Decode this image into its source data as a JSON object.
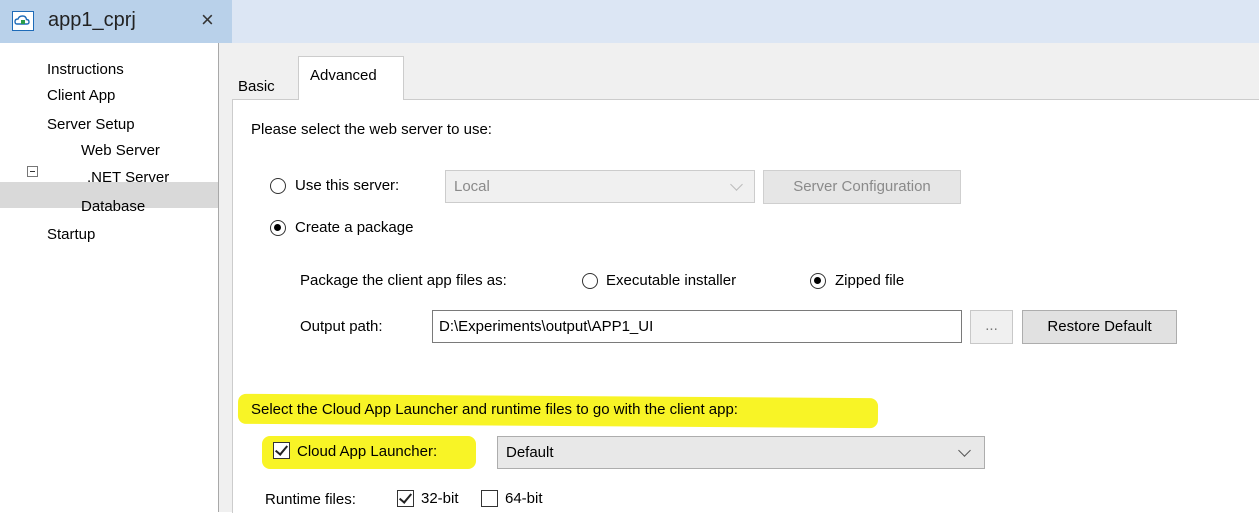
{
  "doc_tab": {
    "title": "app1_cprj",
    "close": "×",
    "icon": "cloud-project-icon"
  },
  "tree": {
    "items": [
      "Instructions",
      "Client App",
      "Server Setup",
      "Web Server",
      ".NET Server",
      "Database",
      "Startup"
    ],
    "selected": "Web Server"
  },
  "tabs": {
    "basic": "Basic",
    "advanced": "Advanced",
    "active": "Advanced"
  },
  "web_server": {
    "prompt": "Please select the web server to use:",
    "use_server_label": "Use this server:",
    "use_server_selected": false,
    "server_value": "Local",
    "server_config_button": "Server Configuration",
    "create_package_label": "Create a package",
    "create_package_selected": true,
    "package_as_label": "Package the client app files as:",
    "executable_installer": "Executable installer",
    "zipped_file": "Zipped file",
    "package_format_selected": "Zipped file",
    "output_path_label": "Output path:",
    "output_path_value": "D:\\Experiments\\output\\APP1_UI",
    "browse_button": "...",
    "restore_default_button": "Restore Default"
  },
  "launcher": {
    "prompt": "Select the Cloud App Launcher and runtime files to go with the client app:",
    "checkbox_label": "Cloud App Launcher:",
    "checked": true,
    "value": "Default",
    "runtime_label": "Runtime files:",
    "bit32": "32-bit",
    "bit32_checked": true,
    "bit64": "64-bit",
    "bit64_checked": false
  },
  "colors": {
    "highlight": "#f7f200",
    "tab_active": "#b9d1ea",
    "selection": "#d9d9d9"
  }
}
